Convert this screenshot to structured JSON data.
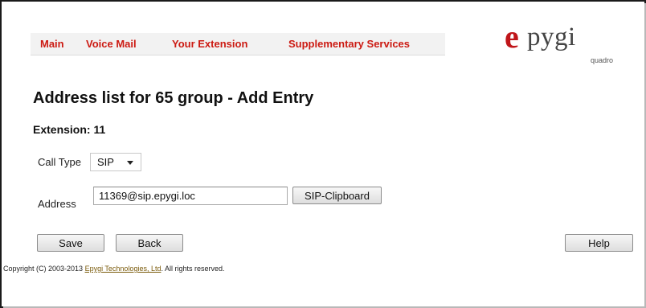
{
  "nav": {
    "items": [
      {
        "label": "Main"
      },
      {
        "label": "Voice Mail"
      },
      {
        "label": "Your Extension"
      },
      {
        "label": "Supplementary Services"
      }
    ]
  },
  "logo": {
    "mark": "e",
    "text": "pygi",
    "subtitle": "quadro"
  },
  "page": {
    "title": "Address list for 65 group - Add Entry",
    "extension_heading": "Extension: 11"
  },
  "form": {
    "call_type": {
      "label": "Call Type",
      "value": "SIP"
    },
    "address": {
      "label": "Address",
      "value": "11369@sip.epygi.loc"
    },
    "sip_clipboard_label": "SIP-Clipboard"
  },
  "actions": {
    "save_label": "Save",
    "back_label": "Back",
    "help_label": "Help"
  },
  "footer": {
    "prefix": "Copyright (C) 2003-2013 ",
    "company_link": "Epygi Technologies, Ltd",
    "suffix": ". All rights reserved."
  },
  "colors": {
    "nav_text": "#cc1a12",
    "logo_red": "#c0161a",
    "frame": "#1a1a1a"
  }
}
